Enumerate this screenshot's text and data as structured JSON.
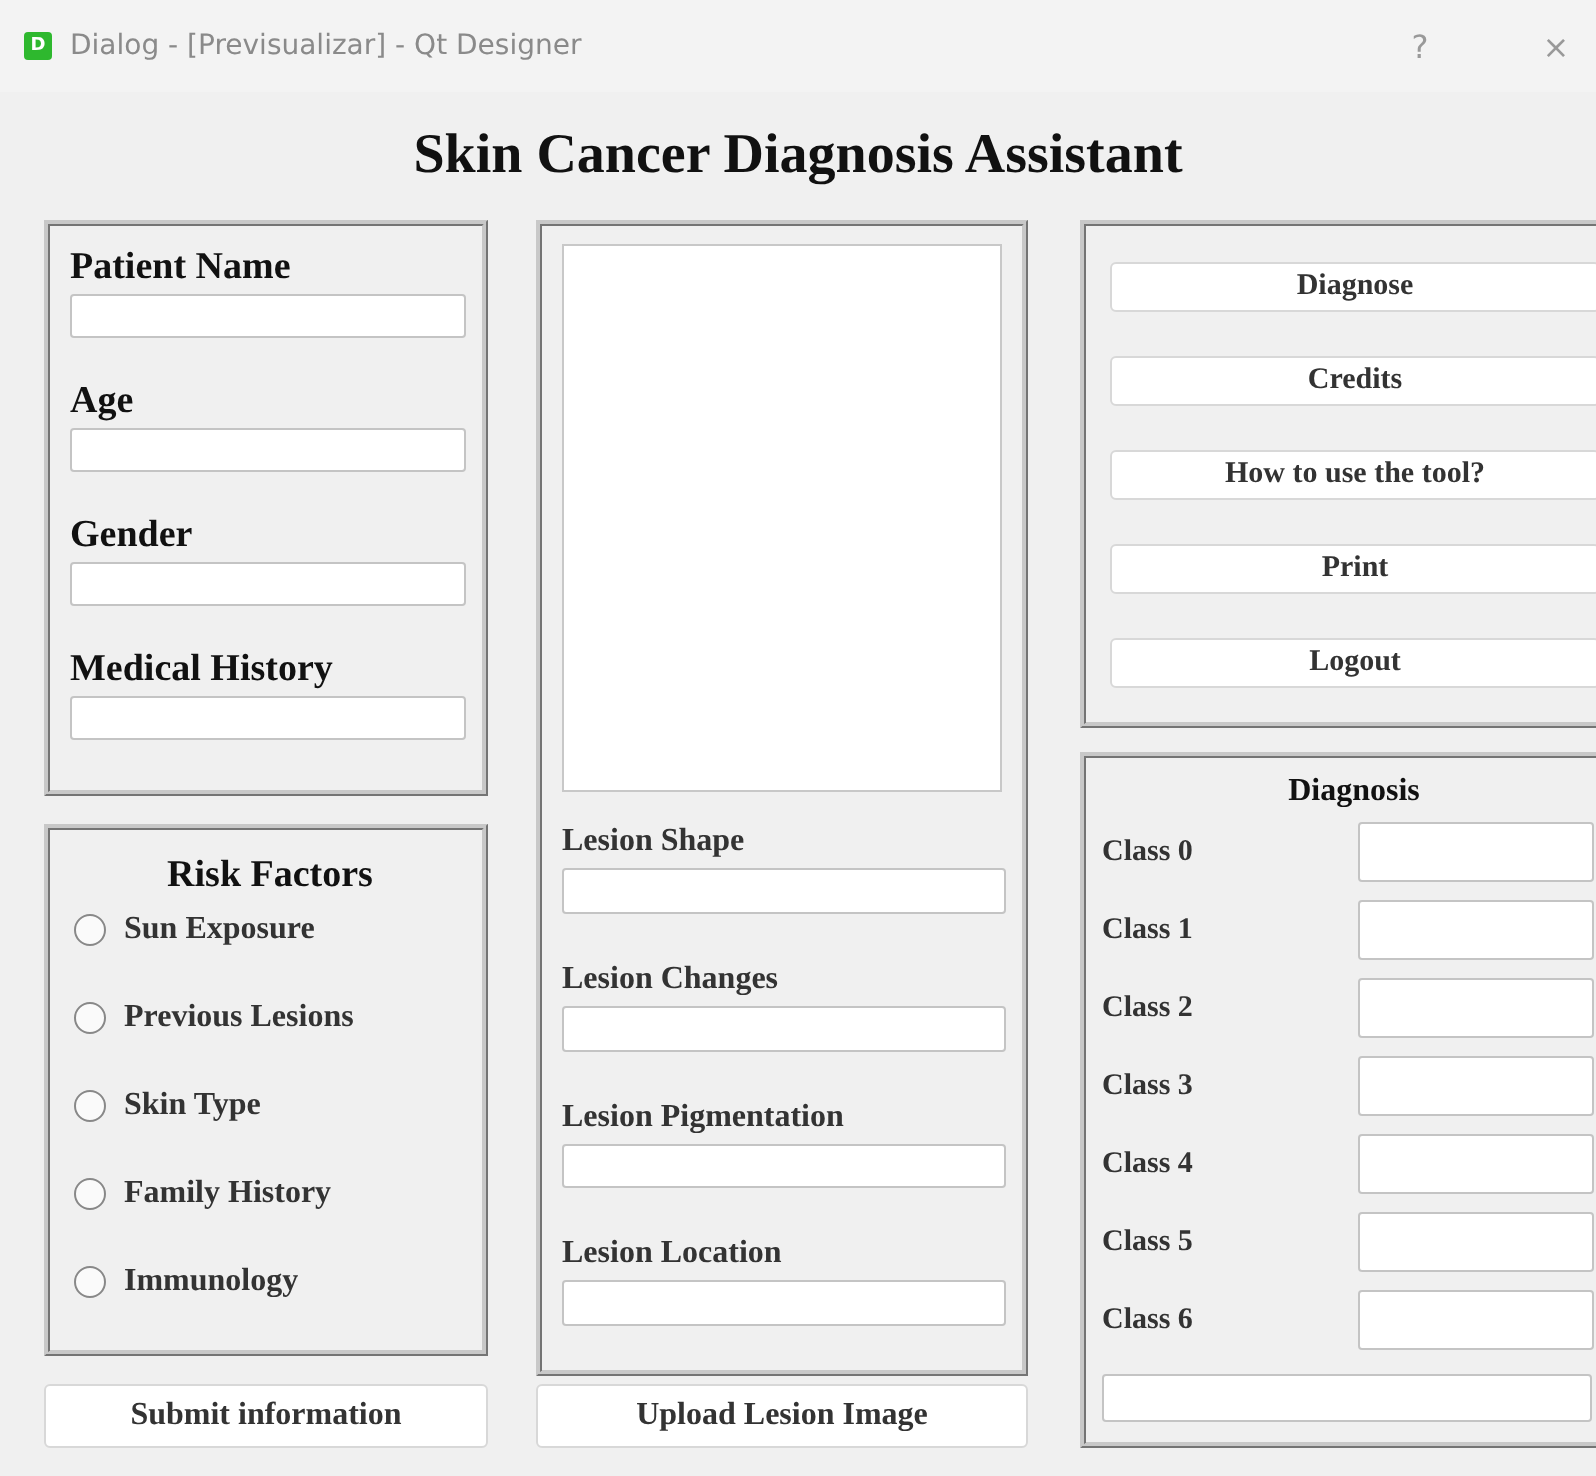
{
  "window": {
    "title": "Dialog - [Previsualizar] - Qt Designer",
    "app_icon_letter": "D",
    "controls": [
      "?",
      "×"
    ]
  },
  "heading": "Skin Cancer Diagnosis Assistant",
  "patient_fields": [
    {
      "label": "Patient Name"
    },
    {
      "label": "Age"
    },
    {
      "label": "Gender"
    },
    {
      "label": "Medical History"
    }
  ],
  "risk_factors": {
    "title": "Risk Factors",
    "options": [
      {
        "label": "Sun Exposure",
        "selected": false
      },
      {
        "label": "Previous Lesions",
        "selected": false
      },
      {
        "label": "Skin Type",
        "selected": false
      },
      {
        "label": "Family History",
        "selected": false
      },
      {
        "label": "Immunology",
        "selected": false
      }
    ]
  },
  "submit_button": "Submit information",
  "lesion_fields": [
    {
      "label": "Lesion Shape"
    },
    {
      "label": "Lesion Changes"
    },
    {
      "label": "Lesion Pigmentation"
    },
    {
      "label": "Lesion Location"
    }
  ],
  "upload_button": "Upload Lesion Image",
  "actions": [
    "Diagnose",
    "Credits",
    "How to use the tool?",
    "Print",
    "Logout"
  ],
  "diagnosis": {
    "title": "Diagnosis",
    "classes": [
      {
        "label": "Class 0"
      },
      {
        "label": "Class 1"
      },
      {
        "label": "Class 2"
      },
      {
        "label": "Class 3"
      },
      {
        "label": "Class 4"
      },
      {
        "label": "Class 5"
      },
      {
        "label": "Class 6"
      }
    ]
  }
}
